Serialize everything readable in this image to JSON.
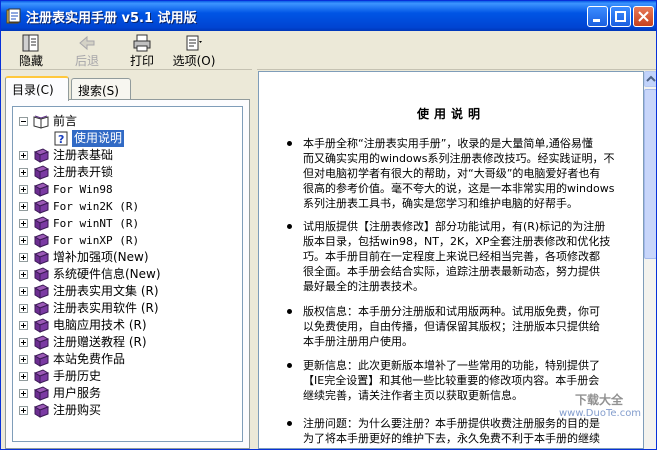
{
  "window": {
    "title": "注册表实用手册 v5.1 试用版",
    "colors": {
      "titlebar": "#0055e5",
      "selection": "#316ac5",
      "close": "#c6401c"
    }
  },
  "toolbar": {
    "items": [
      {
        "label": "隐藏",
        "icon": "hide-icon",
        "enabled": true
      },
      {
        "label": "后退",
        "icon": "back-arrow-icon",
        "enabled": false
      },
      {
        "label": "打印",
        "icon": "printer-icon",
        "enabled": true
      },
      {
        "label": "选项(O)",
        "icon": "options-icon",
        "enabled": true
      }
    ]
  },
  "tabs": {
    "contents": "目录(C)",
    "search": "搜索(S)"
  },
  "tree": {
    "root": {
      "label": "前言",
      "icon": "open-book-icon"
    },
    "selected": {
      "label": "使用说明",
      "icon": "help-page-icon"
    },
    "items": [
      {
        "label": "注册表基础"
      },
      {
        "label": "注册表开锁"
      },
      {
        "label": "For Win98"
      },
      {
        "label": "For win2K (R)"
      },
      {
        "label": "For winNT (R)"
      },
      {
        "label": "For winXP (R)"
      },
      {
        "label": "增补加强项(New)"
      },
      {
        "label": "系统硬件信息(New)"
      },
      {
        "label": "注册表实用文集 (R)"
      },
      {
        "label": "注册表实用软件 (R)"
      },
      {
        "label": "电脑应用技术 (R)"
      },
      {
        "label": "注册赠送教程 (R)"
      },
      {
        "label": "本站免费作品"
      },
      {
        "label": "手册历史"
      },
      {
        "label": "用户服务"
      },
      {
        "label": "注册购买"
      }
    ]
  },
  "content": {
    "title": "使用说明",
    "paragraphs": [
      [
        "本手册全称“注册表实用手册”，收录的是大量简单,通俗易懂",
        "而又确实实用的windows系列注册表修改技巧。经实践证明，不",
        "但对电脑初学者有很大的帮助，对“大哥级”的电脑爱好者也有",
        "很高的参考价值。毫不夸大的说，这是一本非常实用的windows",
        "系列注册表工具书，确实是您学习和维护电脑的好帮手。"
      ],
      [
        "试用版提供【注册表修改】部分功能试用，有(R)标记的为注册",
        "版本目录，包括win98，NT，2K，XP全套注册表修改和优化技",
        "巧。本手册目前在一定程度上来说已经相当完善，各项修改都",
        "很全面。本手册会结合实际，追踪注册表最新动态，努力提供",
        "最好最全的注册表技术。"
      ],
      [
        "版权信息：本手册分注册版和试用版两种。试用版免费，你可",
        "以免费使用，自由传播，但请保留其版权；注册版本只提供给",
        "本手册注册用户使用。"
      ],
      [
        "更新信息：此次更新版本增补了一些常用的功能，特别提供了",
        "【IE完全设置】和其他一些比较重要的修改项内容。本手册会",
        "继续完善，请关注作者主页以获取更新信息。"
      ],
      [
        "注册问题：为什么要注册？本手册提供收费注册服务的目的是",
        "为了将本手册更好的维护下去，永久免费不利于本手册的继续"
      ]
    ]
  },
  "watermark": {
    "line1": "下载大全",
    "line2": "www.DuoTe.com"
  }
}
